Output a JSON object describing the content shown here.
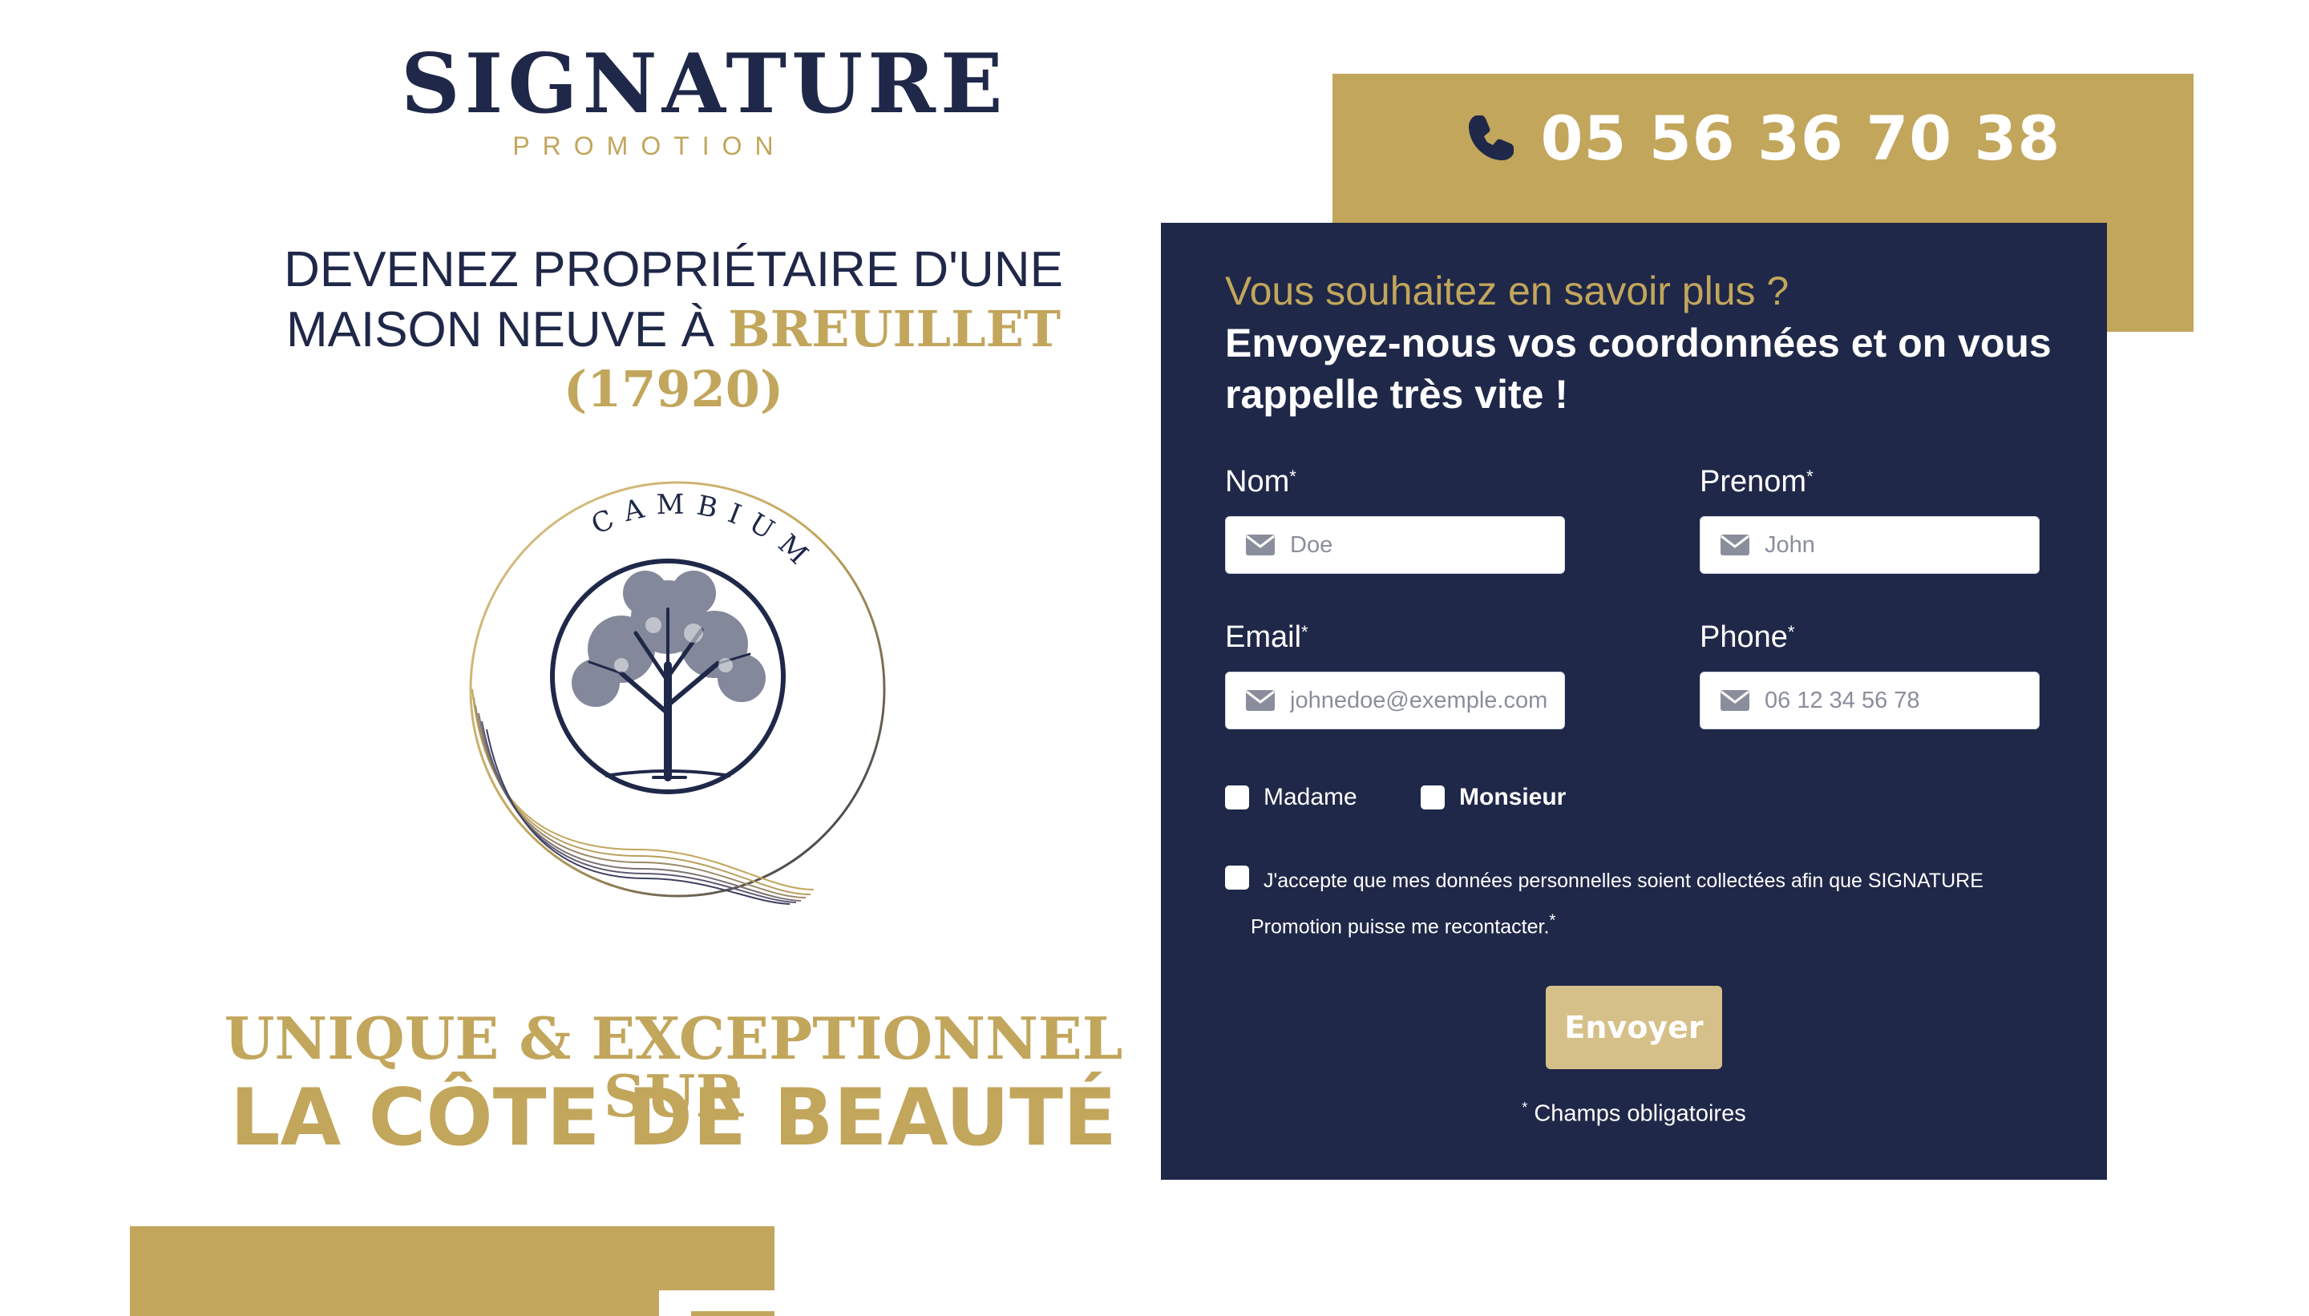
{
  "brand": {
    "name": "SIGNATURE",
    "tagline": "PROMOTION"
  },
  "headline": {
    "line1": "DEVENEZ PROPRIÉTAIRE D'UNE",
    "line2_prefix": "MAISON NEUVE À ",
    "location": "BREUILLET (17920)"
  },
  "emblem": {
    "text": "CAMBIUM"
  },
  "tagline": {
    "line1": "UNIQUE & EXCEPTIONNEL SUR",
    "line2": "LA CÔTE DE BEAUTÉ"
  },
  "phone": {
    "number": "05 56 36 70 38",
    "icon": "phone-icon"
  },
  "form": {
    "question": "Vous souhaitez en savoir plus ?",
    "lead": "Envoyez-nous vos coordonnées et on vous rappelle très vite !",
    "fields": {
      "nom": {
        "label": "Nom",
        "placeholder": "Doe",
        "icon": "mail-icon"
      },
      "prenom": {
        "label": "Prenom",
        "placeholder": "John",
        "icon": "mail-icon"
      },
      "email": {
        "label": "Email",
        "placeholder": "johnedoe@exemple.com",
        "icon": "mail-icon"
      },
      "phone": {
        "label": "Phone",
        "placeholder": "06 12 34 56 78",
        "icon": "mail-icon"
      }
    },
    "required_mark": "*",
    "civility": {
      "madame": "Madame",
      "monsieur": "Monsieur"
    },
    "consent_line1": "J'accepte que mes données personnelles soient collectées afin que SIGNATURE",
    "consent_line2": "Promotion puisse me recontacter.",
    "submit_label": "Envoyer",
    "required_note": "Champs obligatoires"
  },
  "colors": {
    "navy": "#1f2848",
    "gold": "#c2a65c",
    "button": "#d6c089",
    "white": "#ffffff"
  }
}
